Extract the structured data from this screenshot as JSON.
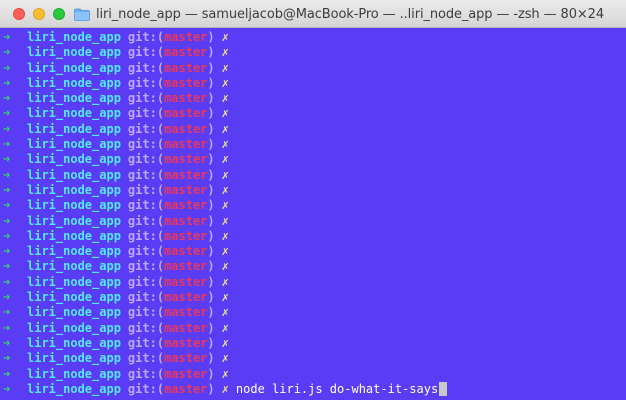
{
  "window": {
    "title": "liri_node_app — samueljacob@MacBook-Pro — ..liri_node_app — -zsh — 80×24",
    "colors": {
      "background": "#5b3cf5",
      "arrow": "#2fd46a",
      "dir": "#53e8ff",
      "git": "#bca8ff",
      "branch": "#e9385a",
      "dirty": "#f1e48b"
    }
  },
  "prompt": {
    "arrow": "➜",
    "directory": "liri_node_app",
    "git_label": "git:",
    "open_paren": "(",
    "branch": "master",
    "close_paren": ")",
    "dirty_mark": "✗"
  },
  "empty_prompt_count": 23,
  "current_command": "node liri.js do-what-it-says"
}
